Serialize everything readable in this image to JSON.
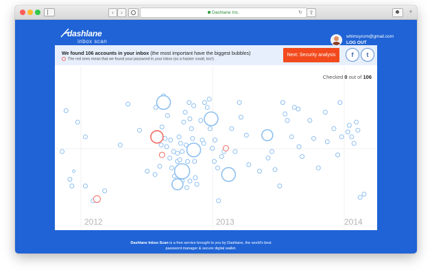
{
  "browser": {
    "url": "Dashlane Inc."
  },
  "brand": {
    "logo_word": "dashlane",
    "logo_sub": "inbox scan"
  },
  "user": {
    "email": "whimsyrum@gmail.com",
    "logout": "LOG OUT"
  },
  "banner": {
    "headline_bold": "We found 106 accounts in your inbox",
    "headline_rest": " (the most important have the biggest bubbles)",
    "subnote": "The red ones mean that we found your password in your inbox (so a hacker could, too!)",
    "next_button": "Next: Security analysis",
    "facebook": "f",
    "twitter": "t"
  },
  "status": {
    "checked_prefix": "Checked ",
    "checked_count": "0",
    "checked_mid": " out of ",
    "checked_total": "106"
  },
  "colors": {
    "background": "#1f63d6",
    "bubble": "#8cbff0",
    "bubble_red": "#f26a5e",
    "button": "#f24a1d"
  },
  "chart_data": {
    "type": "scatter",
    "x_axis_labels": [
      "2012",
      "2013",
      "2014"
    ],
    "series": [
      {
        "color": "#8cbff0",
        "points": [
          [
            0.2,
            0.27,
            3
          ],
          [
            0.5,
            0.34,
            3
          ],
          [
            0.7,
            0.43,
            3
          ],
          [
            0.1,
            0.52,
            3
          ],
          [
            0.3,
            0.69,
            3
          ],
          [
            0.35,
            0.73,
            3
          ],
          [
            0.7,
            0.73,
            3
          ],
          [
            0.4,
            0.64,
            2
          ],
          [
            0.9,
            0.82,
            3
          ],
          [
            1.2,
            0.76,
            3
          ],
          [
            1.6,
            0.48,
            3
          ],
          [
            1.8,
            0.23,
            3
          ],
          [
            2.1,
            0.39,
            3
          ],
          [
            2.3,
            0.64,
            3
          ],
          [
            2.5,
            0.66,
            3
          ],
          [
            2.62,
            0.61,
            3
          ],
          [
            2.68,
            0.37,
            3
          ],
          [
            2.76,
            0.44,
            3
          ],
          [
            2.66,
            0.48,
            3
          ],
          [
            2.8,
            0.49,
            3
          ],
          [
            2.9,
            0.45,
            3
          ],
          [
            2.98,
            0.52,
            3
          ],
          [
            2.52,
            0.25,
            3
          ],
          [
            2.72,
            0.18,
            3
          ],
          [
            2.82,
            0.3,
            3
          ],
          [
            2.88,
            0.56,
            3
          ],
          [
            2.93,
            0.62,
            3
          ],
          [
            3.0,
            0.67,
            3
          ],
          [
            3.02,
            0.72,
            3
          ],
          [
            3.08,
            0.58,
            3
          ],
          [
            3.12,
            0.64,
            3
          ],
          [
            3.2,
            0.7,
            3
          ],
          [
            3.12,
            0.43,
            3
          ],
          [
            3.16,
            0.47,
            3
          ],
          [
            3.08,
            0.53,
            3
          ],
          [
            3.14,
            0.57,
            3
          ],
          [
            3.2,
            0.52,
            3
          ],
          [
            3.24,
            0.34,
            3
          ],
          [
            3.28,
            0.28,
            3
          ],
          [
            3.3,
            0.48,
            3
          ],
          [
            3.34,
            0.58,
            3
          ],
          [
            3.26,
            0.66,
            3
          ],
          [
            3.32,
            0.74,
            3
          ],
          [
            3.4,
            0.7,
            3
          ],
          [
            3.38,
            0.22,
            3
          ],
          [
            3.4,
            0.32,
            3
          ],
          [
            3.44,
            0.38,
            3
          ],
          [
            3.47,
            0.44,
            3
          ],
          [
            3.5,
            0.24,
            3
          ],
          [
            3.52,
            0.58,
            3
          ],
          [
            3.54,
            0.68,
            3
          ],
          [
            3.58,
            0.72,
            3
          ],
          [
            3.6,
            0.52,
            3
          ],
          [
            3.68,
            0.33,
            3
          ],
          [
            3.72,
            0.45,
            3
          ],
          [
            3.76,
            0.47,
            3
          ],
          [
            3.78,
            0.22,
            3
          ],
          [
            3.85,
            0.25,
            3
          ],
          [
            3.9,
            0.2,
            3
          ],
          [
            3.92,
            0.38,
            3
          ],
          [
            3.96,
            0.29,
            3
          ],
          [
            3.98,
            0.5,
            3
          ],
          [
            4.03,
            0.58,
            3
          ],
          [
            4.05,
            0.45,
            3
          ],
          [
            4.12,
            0.62,
            3
          ],
          [
            4.14,
            0.82,
            3
          ],
          [
            4.22,
            0.55,
            3
          ],
          [
            4.28,
            0.52,
            3
          ],
          [
            4.48,
            0.38,
            3
          ],
          [
            4.57,
            0.52,
            3
          ],
          [
            4.68,
            0.22,
            3
          ],
          [
            4.72,
            0.31,
            3
          ],
          [
            4.86,
            0.42,
            3
          ],
          [
            4.92,
            0.6,
            3
          ],
          [
            5.2,
            0.64,
            3
          ],
          [
            5.42,
            0.56,
            3
          ],
          [
            5.52,
            0.52,
            3
          ],
          [
            5.6,
            0.63,
            3
          ],
          [
            5.72,
            0.73,
            3
          ],
          [
            5.8,
            0.22,
            3
          ],
          [
            5.86,
            0.29,
            3
          ],
          [
            5.92,
            0.33,
            3
          ],
          [
            6.03,
            0.43,
            3
          ],
          [
            6.1,
            0.25,
            3
          ],
          [
            6.2,
            0.26,
            3
          ],
          [
            6.22,
            0.49,
            3
          ],
          [
            6.3,
            0.55,
            3
          ],
          [
            6.5,
            0.33,
            3
          ],
          [
            6.6,
            0.44,
            3
          ],
          [
            6.72,
            0.62,
            3
          ],
          [
            6.9,
            0.28,
            3
          ],
          [
            6.95,
            0.46,
            3
          ],
          [
            7.12,
            0.38,
            3
          ],
          [
            7.22,
            0.54,
            3
          ],
          [
            7.28,
            0.22,
            3
          ],
          [
            7.32,
            0.43,
            3
          ],
          [
            7.48,
            0.4,
            3
          ],
          [
            7.52,
            0.36,
            3
          ],
          [
            7.58,
            0.43,
            3
          ],
          [
            7.64,
            0.47,
            3
          ],
          [
            7.7,
            0.34,
            3
          ],
          [
            7.74,
            0.39,
            3
          ],
          [
            7.8,
            0.8,
            3
          ],
          [
            7.9,
            0.78,
            3
          ]
        ]
      },
      {
        "color": "#8cbff0",
        "large": true,
        "points": [
          [
            2.72,
            0.22,
            10
          ],
          [
            3.2,
            0.64,
            11
          ],
          [
            3.08,
            0.72,
            8
          ],
          [
            3.5,
            0.51,
            10
          ],
          [
            3.95,
            0.32,
            10
          ],
          [
            4.4,
            0.66,
            10
          ],
          [
            5.4,
            0.42,
            8
          ]
        ]
      },
      {
        "color": "#f26a5e",
        "points": [
          [
            2.55,
            0.43,
            9
          ],
          [
            2.68,
            0.54,
            4
          ],
          [
            4.33,
            0.5,
            4
          ],
          [
            1.0,
            0.81,
            5
          ]
        ]
      }
    ]
  },
  "footer": {
    "bold": "Dashlane Inbox Scan",
    "line1": " is a free service brought to you by Dashlane, the world's best",
    "line2": "password manager & secure digital wallet."
  }
}
